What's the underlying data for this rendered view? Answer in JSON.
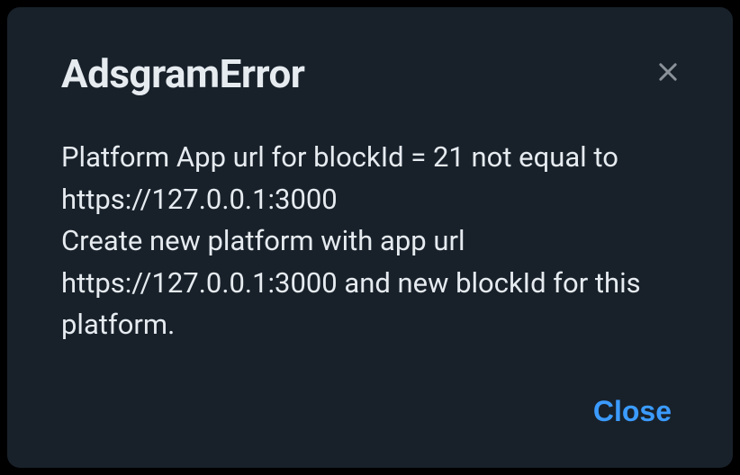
{
  "dialog": {
    "title": "AdsgramError",
    "message": "Platform App url for blockId = 21 not equal to https://127.0.0.1:3000\nCreate new platform with app url https://127.0.0.1:3000 and new blockId for this platform.",
    "close_button_label": "Close"
  }
}
